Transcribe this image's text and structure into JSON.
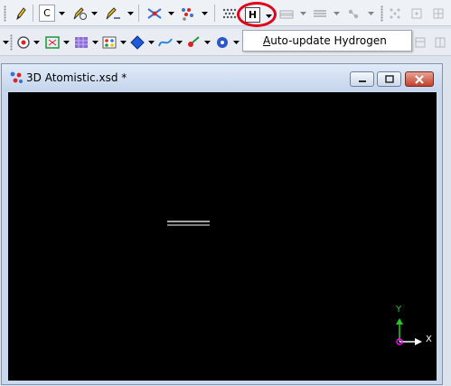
{
  "toolbar1": {
    "element_value": "C",
    "hydrogen_label": "H",
    "items": [
      "pencil-icon",
      "element-box",
      "sketch-atom-icon",
      "sketch-ring-icon",
      "clean-icon",
      "fragment-icon",
      "hydrogen-dots-icon",
      "auto-update-hydrogen-button",
      "measure-icon",
      "align-icon",
      "calc-icon"
    ]
  },
  "tooltip": {
    "underline_char": "A",
    "rest": "uto-update Hydrogen"
  },
  "window": {
    "title": "3D Atomistic.xsd *",
    "axis_y": "Y",
    "axis_x": "X"
  },
  "colors": {
    "highlight_ring": "#e0001a",
    "canvas": "#000000",
    "axis_y": "#22cc22",
    "axis_x": "#ffffff",
    "axis_origin": "#ff00ff"
  }
}
